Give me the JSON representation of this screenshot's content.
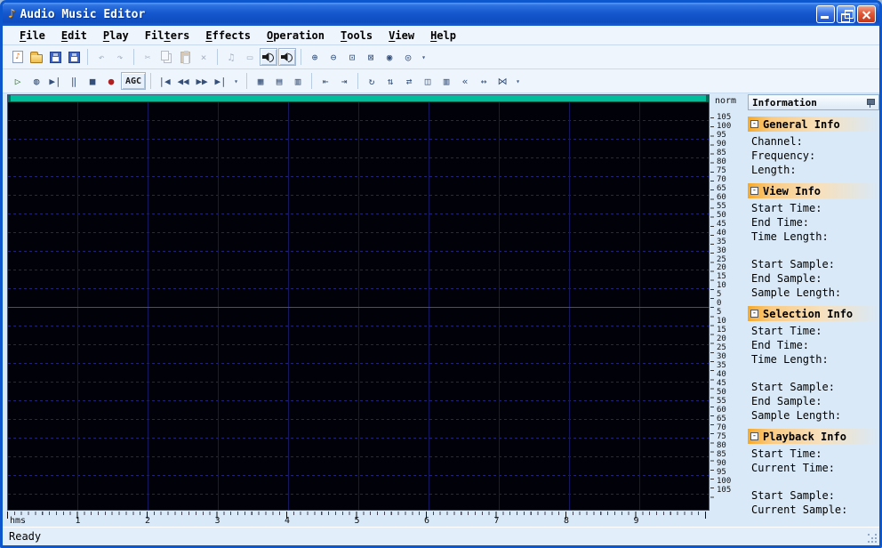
{
  "window": {
    "title": "Audio Music Editor",
    "status": "Ready"
  },
  "titlebar": {
    "app_icon_glyph": "♪"
  },
  "menubar": {
    "items": [
      {
        "label": "File",
        "underline": 0
      },
      {
        "label": "Edit",
        "underline": 0
      },
      {
        "label": "Play",
        "underline": 0
      },
      {
        "label": "Filters",
        "underline": 3
      },
      {
        "label": "Effects",
        "underline": 0
      },
      {
        "label": "Operation",
        "underline": 0
      },
      {
        "label": "Tools",
        "underline": 0
      },
      {
        "label": "View",
        "underline": 0
      },
      {
        "label": "Help",
        "underline": 0
      }
    ]
  },
  "toolbars": {
    "standard": [
      {
        "name": "open-audio",
        "glyph": "♪",
        "style": "page"
      },
      {
        "name": "open-folder",
        "style": "folder"
      },
      {
        "name": "save",
        "style": "disk"
      },
      {
        "name": "save-as",
        "style": "disk"
      },
      {
        "sep": true
      },
      {
        "name": "undo",
        "glyph": "↶",
        "disabled": true
      },
      {
        "name": "redo",
        "glyph": "↷",
        "disabled": true
      },
      {
        "sep": true
      },
      {
        "name": "cut",
        "glyph": "✂",
        "disabled": true
      },
      {
        "name": "copy",
        "style": "copy",
        "disabled": true
      },
      {
        "name": "paste",
        "style": "paste",
        "disabled": true
      },
      {
        "name": "delete",
        "glyph": "×",
        "disabled": true
      },
      {
        "sep": true
      },
      {
        "name": "mix-paste",
        "glyph": "♫",
        "disabled": true
      },
      {
        "name": "trim",
        "glyph": "▭",
        "disabled": true
      },
      {
        "name": "left-channel-toggle",
        "style": "speaker",
        "pressed": true
      },
      {
        "name": "right-channel-toggle",
        "style": "speaker",
        "pressed": true
      },
      {
        "sep": true
      },
      {
        "name": "zoom-in",
        "glyph": "⊕"
      },
      {
        "name": "zoom-out",
        "glyph": "⊖"
      },
      {
        "name": "zoom-selection",
        "glyph": "⊡"
      },
      {
        "name": "zoom-full",
        "glyph": "⊠"
      },
      {
        "name": "zoom-vertical-in",
        "glyph": "◉"
      },
      {
        "name": "zoom-vertical-out",
        "glyph": "◎"
      },
      {
        "name": "standard-overflow",
        "glyph": "▾",
        "overflow": true
      }
    ],
    "playback": [
      {
        "name": "play",
        "glyph": "▷",
        "color": "#2C6E2C"
      },
      {
        "name": "play-all",
        "glyph": "◍"
      },
      {
        "name": "play-to-end",
        "glyph": "▶|"
      },
      {
        "name": "pause",
        "glyph": "‖"
      },
      {
        "name": "stop",
        "glyph": "■"
      },
      {
        "name": "record",
        "glyph": "●",
        "color": "#B02020"
      },
      {
        "name": "agc-toggle",
        "text": "AGC",
        "raised": true
      },
      {
        "sep": true
      },
      {
        "name": "go-start",
        "glyph": "|◀"
      },
      {
        "name": "rewind",
        "glyph": "◀◀"
      },
      {
        "name": "fast-forward",
        "glyph": "▶▶"
      },
      {
        "name": "go-end",
        "glyph": "▶|"
      },
      {
        "name": "playback-overflow",
        "glyph": "▾",
        "overflow": true
      },
      {
        "sep": true
      },
      {
        "name": "grid-toggle",
        "glyph": "▦"
      },
      {
        "name": "h-ruler-toggle",
        "glyph": "▤"
      },
      {
        "name": "v-ruler-toggle",
        "glyph": "▥"
      },
      {
        "sep": true
      },
      {
        "name": "snap-start",
        "glyph": "⇤"
      },
      {
        "name": "snap-end",
        "glyph": "⇥"
      },
      {
        "sep": true
      },
      {
        "name": "loop",
        "glyph": "↻"
      },
      {
        "name": "swap-channels",
        "glyph": "⇅"
      },
      {
        "name": "reverse",
        "glyph": "⇄"
      },
      {
        "name": "channel-view",
        "glyph": "◫"
      },
      {
        "name": "spectrum-view",
        "glyph": "▥"
      },
      {
        "name": "mute",
        "glyph": "«"
      },
      {
        "name": "stretch",
        "glyph": "↔"
      },
      {
        "name": "crossfade",
        "glyph": "⋈"
      },
      {
        "name": "playback-overflow-2",
        "glyph": "▾",
        "overflow": true
      }
    ]
  },
  "workspace": {
    "overview_bar_color": "#00BE9C",
    "center_line_color": "#D81818",
    "v_ruler": {
      "unit": "norm",
      "values": [
        "105",
        "100",
        "95",
        "90",
        "85",
        "80",
        "75",
        "70",
        "65",
        "60",
        "55",
        "50",
        "45",
        "40",
        "35",
        "30",
        "25",
        "20",
        "15",
        "10",
        "5",
        "0",
        "5",
        "10",
        "15",
        "20",
        "25",
        "30",
        "35",
        "40",
        "45",
        "50",
        "55",
        "60",
        "65",
        "70",
        "75",
        "80",
        "85",
        "90",
        "95",
        "100",
        "105"
      ]
    },
    "h_ruler": {
      "unit": "hms",
      "marks": [
        "1",
        "2",
        "3",
        "4",
        "5",
        "6",
        "7",
        "8",
        "9"
      ]
    }
  },
  "info_panel": {
    "title": "Information",
    "collapse_glyph": "-",
    "sections": [
      {
        "title": "General Info",
        "groups": [
          [
            "Channel:",
            "Frequency:",
            "Length:"
          ]
        ]
      },
      {
        "title": "View Info",
        "groups": [
          [
            "Start Time:",
            "End Time:",
            "Time Length:"
          ],
          [
            "Start Sample:",
            "End Sample:",
            "Sample Length:"
          ]
        ]
      },
      {
        "title": "Selection Info",
        "groups": [
          [
            "Start Time:",
            "End Time:",
            "Time Length:"
          ],
          [
            "Start Sample:",
            "End Sample:",
            "Sample Length:"
          ]
        ]
      },
      {
        "title": "Playback Info",
        "groups": [
          [
            "Start Time:",
            "Current Time:"
          ],
          [
            "Start Sample:",
            "Current Sample:"
          ]
        ]
      }
    ]
  }
}
